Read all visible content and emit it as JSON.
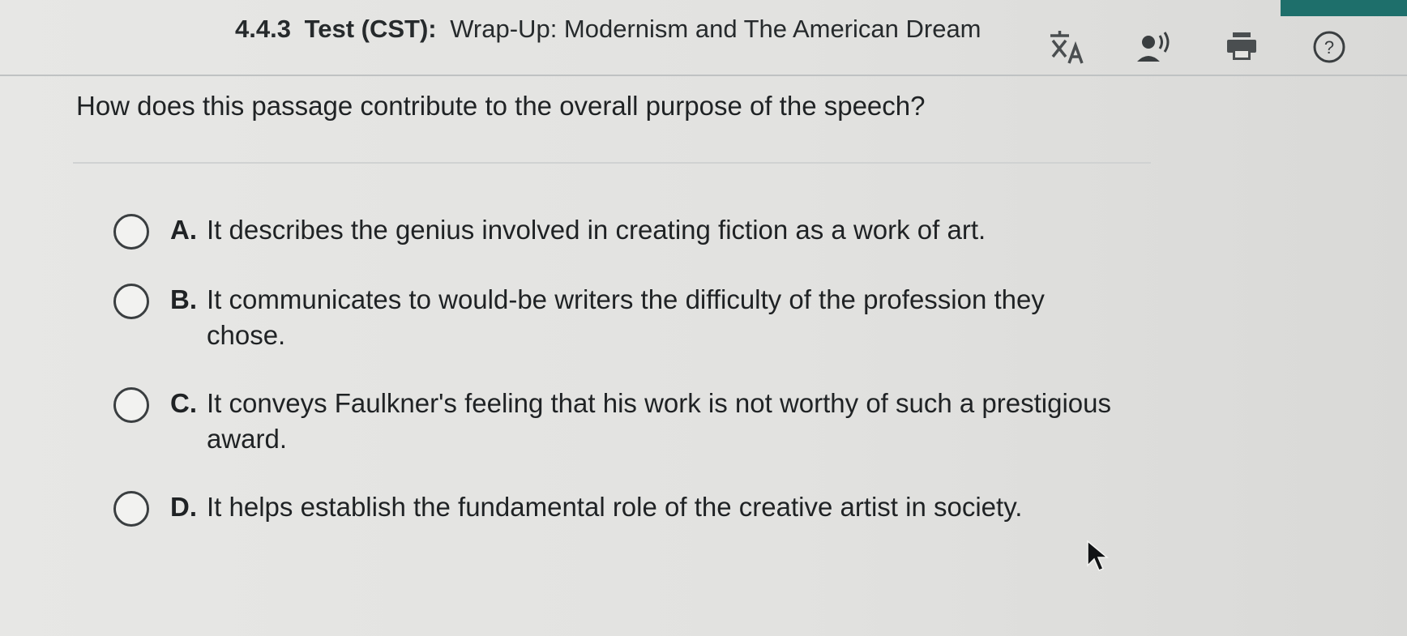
{
  "header": {
    "code": "4.4.3",
    "label": "Test (CST):",
    "title": "Wrap-Up: Modernism and The American Dream"
  },
  "toolbar": {
    "icons": [
      "translate-icon",
      "read-aloud-icon",
      "print-icon",
      "help-icon"
    ]
  },
  "question": {
    "prompt": "How does this passage contribute to the overall purpose of the speech?"
  },
  "options": [
    {
      "letter": "A.",
      "text": "It describes the genius involved in creating fiction as a work of art."
    },
    {
      "letter": "B.",
      "text": "It communicates to would-be writers the difficulty of the profession they chose."
    },
    {
      "letter": "C.",
      "text": "It conveys Faulkner's feeling that his work is not worthy of such a prestigious award."
    },
    {
      "letter": "D.",
      "text": "It helps establish the fundamental role of the creative artist in society."
    }
  ],
  "colors": {
    "accent": "#1e6f6b",
    "text": "#1f2224",
    "background": "#e4e4e2"
  }
}
